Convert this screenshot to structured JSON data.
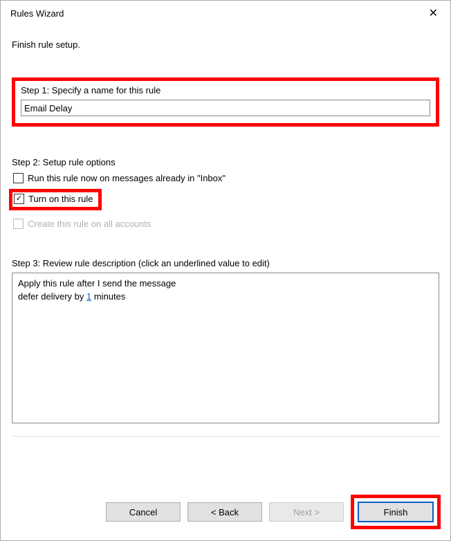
{
  "title": "Rules Wizard",
  "intro": "Finish rule setup.",
  "step1": {
    "label": "Step 1: Specify a name for this rule",
    "value": "Email Delay"
  },
  "step2": {
    "label": "Step 2: Setup rule options",
    "opt_run_now": "Run this rule now on messages already in \"Inbox\"",
    "opt_turn_on": "Turn on this rule",
    "opt_all_accounts": "Create this rule on all accounts"
  },
  "step3": {
    "label": "Step 3: Review rule description (click an underlined value to edit)",
    "line1": "Apply this rule after I send the message",
    "line2a": "defer delivery by ",
    "line2_link": "1",
    "line2b": " minutes"
  },
  "buttons": {
    "cancel": "Cancel",
    "back": "< Back",
    "next": "Next >",
    "finish": "Finish"
  },
  "icons": {
    "checkmark": "✓"
  }
}
